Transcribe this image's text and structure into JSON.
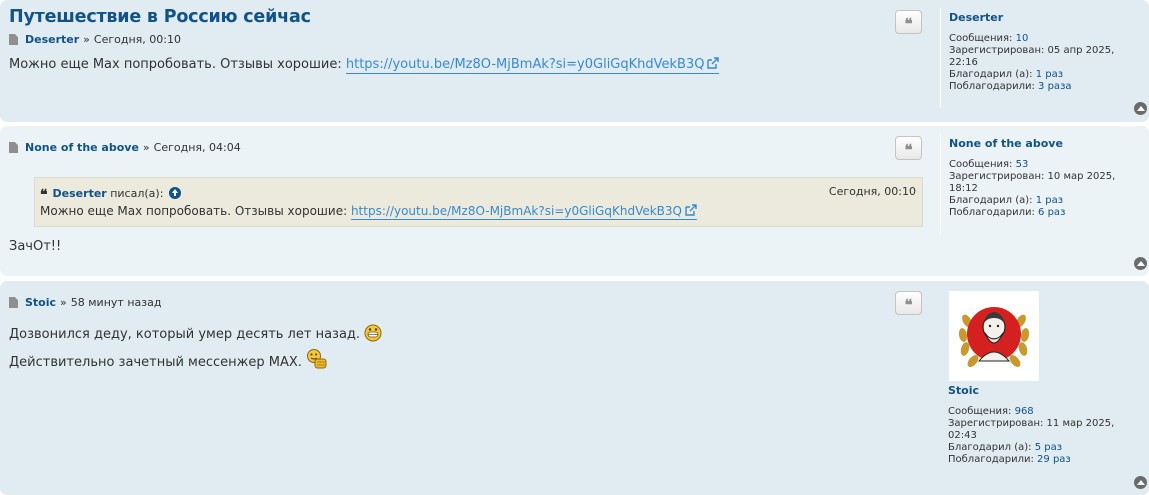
{
  "topic_title": "Путешествие в Россию сейчас",
  "posts": [
    {
      "author": "Deserter",
      "sep": "»",
      "time": "Сегодня, 00:10",
      "text": "Можно еще Max попробовать. Отзывы хорошие:",
      "link": "https://youtu.be/Mz8O-MjBmAk?si=y0GliGqKhdVekB3Q",
      "profile": {
        "name": "Deserter",
        "posts_label": "Сообщения:",
        "posts_value": "10",
        "reg_label": "Зарегистрирован:",
        "reg_value_a": "05 апр 2025,",
        "reg_value_b": "22:16",
        "thanked_label": "Благодарил (а):",
        "thanked_value": "1 раз",
        "got_thanks_label": "Поблагодарили:",
        "got_thanks_value": "3 раза"
      }
    },
    {
      "author": "None of the above",
      "sep": "»",
      "time": "Сегодня, 04:04",
      "quote": {
        "author": "Deserter",
        "wrote": "писал(а):",
        "date": "Сегодня, 00:10",
        "text": "Можно еще Max попробовать. Отзывы хорошие:",
        "link": "https://youtu.be/Mz8O-MjBmAk?si=y0GliGqKhdVekB3Q"
      },
      "text": "ЗачОт!!",
      "profile": {
        "name": "None of the above",
        "posts_label": "Сообщения:",
        "posts_value": "53",
        "reg_label": "Зарегистрирован:",
        "reg_value_a": "10 мар 2025,",
        "reg_value_b": "18:12",
        "thanked_label": "Благодарил (а):",
        "thanked_value": "1 раз",
        "got_thanks_label": "Поблагодарили:",
        "got_thanks_value": "6 раз"
      }
    },
    {
      "author": "Stoic",
      "sep": "»",
      "time": "58 минут назад",
      "line1": "Дозвонился деду, который умер десять лет назад.",
      "line2": "Действительно зачетный мессенжер MAX.",
      "profile": {
        "name": "Stoic",
        "posts_label": "Сообщения:",
        "posts_value": "968",
        "reg_label": "Зарегистрирован:",
        "reg_value_a": "11 мар 2025,",
        "reg_value_b": "02:43",
        "thanked_label": "Благодарил (а):",
        "thanked_value": "5 раз",
        "got_thanks_label": "Поблагодарили:",
        "got_thanks_value": "29 раз"
      }
    }
  ],
  "quote_glyph": "❝",
  "icons": {
    "post": "document-icon",
    "quote": "quote-icon",
    "top": "back-to-top-icon",
    "external": "external-link-icon",
    "go_to_quote": "arrow-up-circle-icon"
  },
  "colors": {
    "post_bg_dark": "#e1ebf2",
    "post_bg_light": "#ecf3f7",
    "link": "#105289",
    "external_link": "#368ad2",
    "quote_bg": "#ebeadd"
  }
}
